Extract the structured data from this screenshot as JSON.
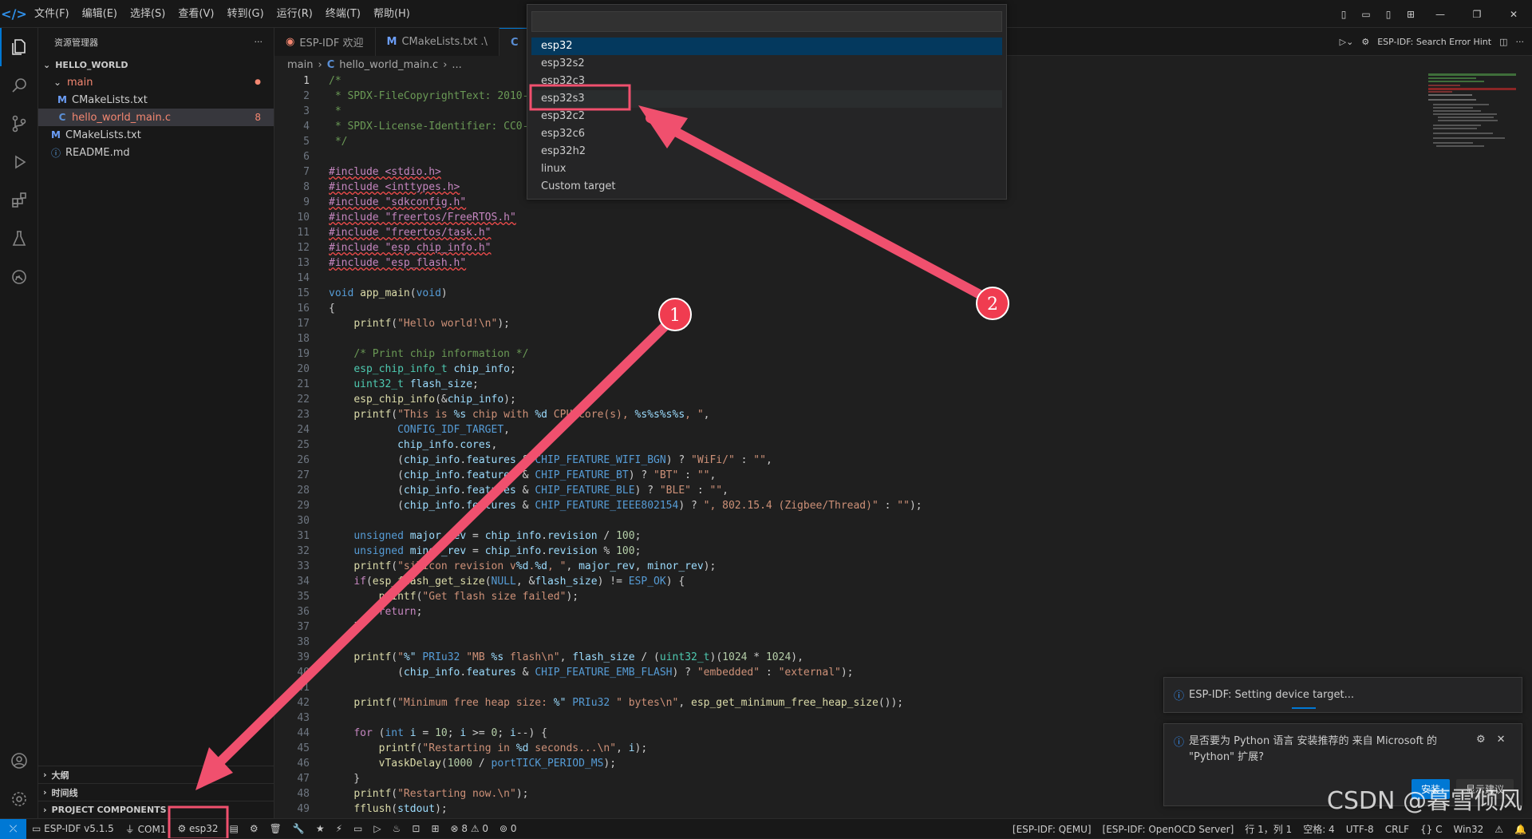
{
  "titlebar": {
    "menu": [
      "文件(F)",
      "编辑(E)",
      "选择(S)",
      "查看(V)",
      "转到(G)",
      "运行(R)",
      "终端(T)",
      "帮助(H)"
    ]
  },
  "sidebar": {
    "title": "资源管理器",
    "more": "···",
    "project": "HELLO_WORLD",
    "tree": [
      {
        "label": "main",
        "icon": "chevron-down-icon",
        "badge": "●"
      },
      {
        "label": "CMakeLists.txt",
        "icon": "M"
      },
      {
        "label": "hello_world_main.c",
        "icon": "C",
        "badge": "8"
      },
      {
        "label": "CMakeLists.txt",
        "icon": "M"
      },
      {
        "label": "README.md",
        "icon": "ⓘ"
      }
    ],
    "bottom_sections": [
      "大纲",
      "时间线",
      "PROJECT COMPONENTS"
    ]
  },
  "tabs": [
    {
      "label": "ESP-IDF 欢迎",
      "icon": "esp-icon"
    },
    {
      "label": "CMakeLists.txt  .\\",
      "icon": "M"
    },
    {
      "label": "",
      "icon": "C"
    }
  ],
  "tab_tools": {
    "hint": "ESP-IDF: Search Error Hint"
  },
  "breadcrumb": {
    "folder": "main",
    "file": "hello_world_main.c",
    "more": "..."
  },
  "editor": {
    "current_line": "1",
    "line_numbers": [
      "1",
      "2",
      "3",
      "4",
      "5",
      "6",
      "7",
      "8",
      "9",
      "10",
      "11",
      "12",
      "13",
      "14",
      "15",
      "16",
      "17",
      "18",
      "19",
      "20",
      "21",
      "22",
      "23",
      "24",
      "25",
      "26",
      "27",
      "28",
      "29",
      "30",
      "31",
      "32",
      "33",
      "34",
      "35",
      "36",
      "37",
      "38",
      "39",
      "40",
      "41",
      "42",
      "43",
      "44",
      "45",
      "46",
      "47",
      "48",
      "49"
    ]
  },
  "quickpick": {
    "placeholder": "",
    "items": [
      "esp32",
      "esp32s2",
      "esp32c3",
      "esp32s3",
      "esp32c2",
      "esp32c6",
      "esp32h2",
      "linux",
      "Custom target"
    ],
    "selected": "esp32",
    "highlighted": "esp32s3"
  },
  "annotations": {
    "one": "1",
    "two": "2",
    "color": "#f0506e"
  },
  "notifications": {
    "progress": "ESP-IDF: Setting device target...",
    "python": "是否要为 Python 语言 安装推荐的 来自 Microsoft 的 \"Python\" 扩展?",
    "install": "安装",
    "show": "显示建议"
  },
  "statusbar": {
    "idf_version": "ESP-IDF v5.1.5",
    "port": "COM1",
    "target": "esp32",
    "problems": "⊗ 8 ⚠ 0",
    "ports": "0",
    "qemu": "[ESP-IDF: QEMU]",
    "openocd": "[ESP-IDF: OpenOCD Server]",
    "position": "行 1，列 1",
    "spaces": "空格: 4",
    "encoding": "UTF-8",
    "eol": "CRLF",
    "lang": "{} C",
    "platform": "Win32"
  },
  "watermark": "CSDN @暮雪倾风"
}
